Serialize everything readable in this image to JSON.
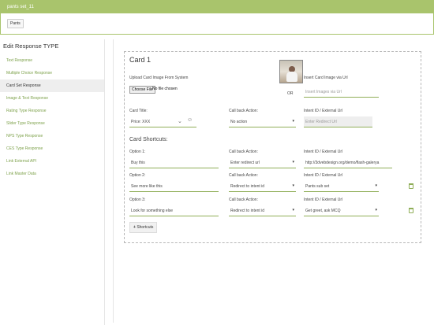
{
  "header": {
    "title": "pants set_11",
    "chip": "Pants"
  },
  "sidebar": {
    "title": "Edit Response TYPE",
    "items": [
      {
        "label": "Text Response",
        "active": false
      },
      {
        "label": "Multiple Choice Response",
        "active": false
      },
      {
        "label": "Card Set Response",
        "active": true
      },
      {
        "label": "Image & Text Response",
        "active": false
      },
      {
        "label": "Rating Type Response",
        "active": false
      },
      {
        "label": "Slider Type Response",
        "active": false
      },
      {
        "label": "NPS Type Response",
        "active": false
      },
      {
        "label": "CES Type Response",
        "active": false
      },
      {
        "label": "Link External API",
        "active": false
      },
      {
        "label": "Link Master Data",
        "active": false
      }
    ]
  },
  "card": {
    "title": "Card 1",
    "upload_label": "Upload Card Image From System",
    "choose_file": "Choose File",
    "no_file": "No file chosen",
    "or": "OR",
    "insert_label": "Insert Card Image via Url",
    "insert_placeholder": "Insert Images via Url",
    "card_title_label": "Card Title:",
    "card_title_value": "Price: XXX",
    "callback_label": "Call back Action:",
    "callback_value": "No action",
    "intent_label": "Intent ID / External Url",
    "intent_placeholder": "Enter Redirect Url"
  },
  "shortcuts": {
    "title": "Card Shortcuts:",
    "callback_label": "Call back Action:",
    "intent_label": "Intent ID / External Url",
    "rows": [
      {
        "label": "Option 1:",
        "value": "Buy this",
        "action": "Enter redirect url",
        "intent": "http://3dvebdesign.org/demo/flash-galerya"
      },
      {
        "label": "Option 2:",
        "value": "See more like this",
        "action": "Redirect to intent id",
        "intent": "Pants sub set"
      },
      {
        "label": "Option 3:",
        "value": "Look for something else",
        "action": "Redirect to intent id",
        "intent": "Get greet, ask MCQ"
      }
    ],
    "add_label": "Shortcuts"
  },
  "icons": {
    "card_title_icons": [
      "bold-chevrons-icon",
      "emoji-icon"
    ],
    "row_delete_icon": "trash-icon"
  },
  "colors": {
    "accent": "#a9c46c",
    "link": "#7da14a",
    "sidebar_active": "#eeeeee"
  }
}
